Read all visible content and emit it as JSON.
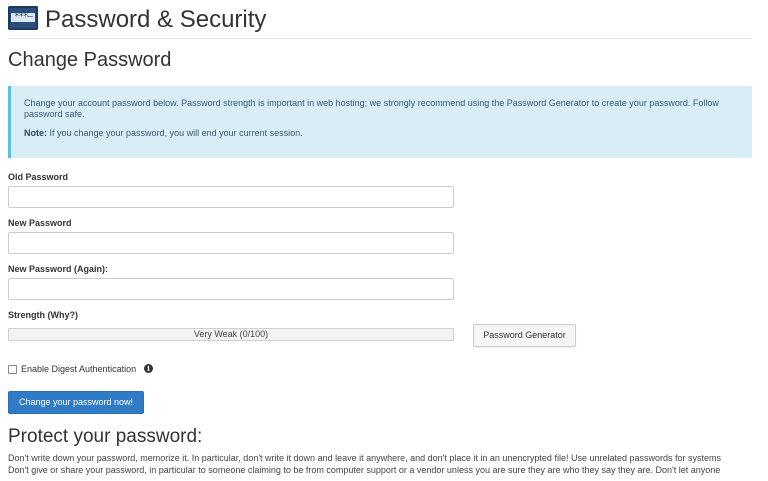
{
  "header": {
    "icon": "password-security-icon",
    "icon_text": "***–",
    "title": "Password & Security"
  },
  "section_title": "Change Password",
  "info": {
    "line1": "Change your account password below. Password strength is important in web hosting; we strongly recommend using the Password Generator to create your password. Follow",
    "line2": "password safe.",
    "note_label": "Note:",
    "note_text": " If you change your password, you will end your current session."
  },
  "form": {
    "old_password_label": "Old Password",
    "old_password_value": "",
    "new_password_label": "New Password",
    "new_password_value": "",
    "new_password_again_label": "New Password (Again):",
    "new_password_again_value": "",
    "strength_label": "Strength (Why?)",
    "strength_text": "Very Weak (0/100)",
    "strength_value": 0,
    "generator_button": "Password Generator",
    "digest_label": "Enable Digest Authentication",
    "digest_checked": false,
    "submit_button": "Change your password now!"
  },
  "protect": {
    "title": "Protect your password:",
    "line1": "Don't write down your password, memorize it. In particular, don't write it down and leave it anywhere, and don't place it in an unencrypted file! Use unrelated passwords for systems",
    "line2": "Don't give or share your password, in particular to someone claiming to be from computer support or a vendor unless you are sure they are who they say they are. Don't let anyone"
  },
  "colors": {
    "info_bg": "#d9edf7",
    "info_border": "#5bc0de",
    "primary_button": "#2f7bc5",
    "strength_fill": "#d9534f"
  }
}
